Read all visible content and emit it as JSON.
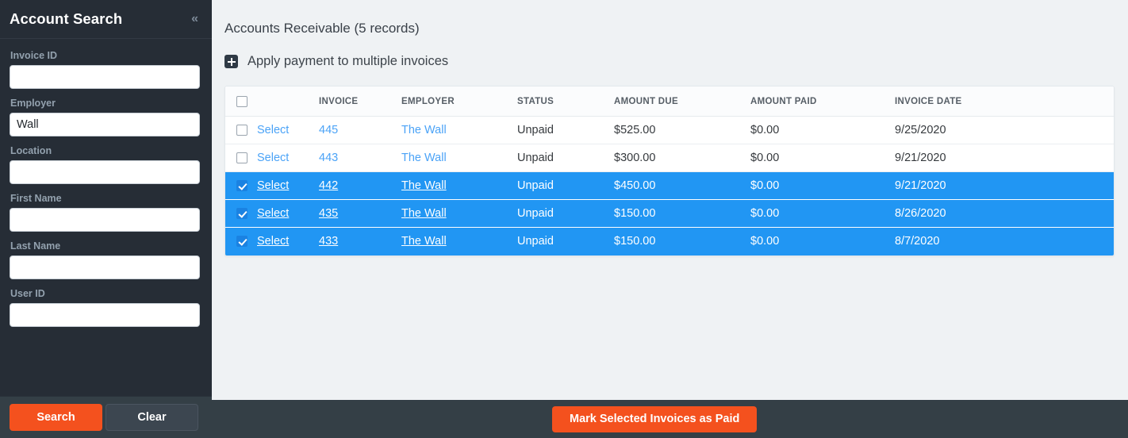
{
  "sidebar": {
    "title": "Account Search",
    "collapse_icon": "chevron-double-left-icon",
    "fields": [
      {
        "label": "Invoice ID",
        "value": "",
        "placeholder": ""
      },
      {
        "label": "Employer",
        "value": "Wall",
        "placeholder": ""
      },
      {
        "label": "Location",
        "value": "",
        "placeholder": ""
      },
      {
        "label": "First Name",
        "value": "",
        "placeholder": ""
      },
      {
        "label": "Last Name",
        "value": "",
        "placeholder": ""
      },
      {
        "label": "User ID",
        "value": "",
        "placeholder": ""
      }
    ],
    "search_label": "Search",
    "clear_label": "Clear"
  },
  "main": {
    "records_title": "Accounts Receivable (5 records)",
    "apply_payment_label": "Apply payment to multiple invoices",
    "plus_icon": "plus-square-icon",
    "mark_paid_label": "Mark Selected Invoices as Paid"
  },
  "table": {
    "headers": [
      "",
      "INVOICE",
      "EMPLOYER",
      "STATUS",
      "AMOUNT DUE",
      "AMOUNT PAID",
      "INVOICE DATE"
    ],
    "select_link_label": "Select",
    "header_checkbox_checked": false,
    "rows": [
      {
        "checked": false,
        "select": "Select",
        "invoice": "445",
        "employer": "The Wall",
        "status": "Unpaid",
        "amount_due": "$525.00",
        "amount_paid": "$0.00",
        "invoice_date": "9/25/2020"
      },
      {
        "checked": false,
        "select": "Select",
        "invoice": "443",
        "employer": "The Wall",
        "status": "Unpaid",
        "amount_due": "$300.00",
        "amount_paid": "$0.00",
        "invoice_date": "9/21/2020"
      },
      {
        "checked": true,
        "select": "Select",
        "invoice": "442",
        "employer": "The Wall",
        "status": "Unpaid",
        "amount_due": "$450.00",
        "amount_paid": "$0.00",
        "invoice_date": "9/21/2020"
      },
      {
        "checked": true,
        "select": "Select",
        "invoice": "435",
        "employer": "The Wall",
        "status": "Unpaid",
        "amount_due": "$150.00",
        "amount_paid": "$0.00",
        "invoice_date": "8/26/2020"
      },
      {
        "checked": true,
        "select": "Select",
        "invoice": "433",
        "employer": "The Wall",
        "status": "Unpaid",
        "amount_due": "$150.00",
        "amount_paid": "$0.00",
        "invoice_date": "8/7/2020"
      }
    ]
  },
  "colors": {
    "accent_orange": "#f4511e",
    "selected_row_blue": "#2196f3",
    "link_blue": "#4ba3f7",
    "sidebar_dark": "#262d36",
    "footer_dark": "#343f46",
    "page_bg": "#eff2f4"
  }
}
